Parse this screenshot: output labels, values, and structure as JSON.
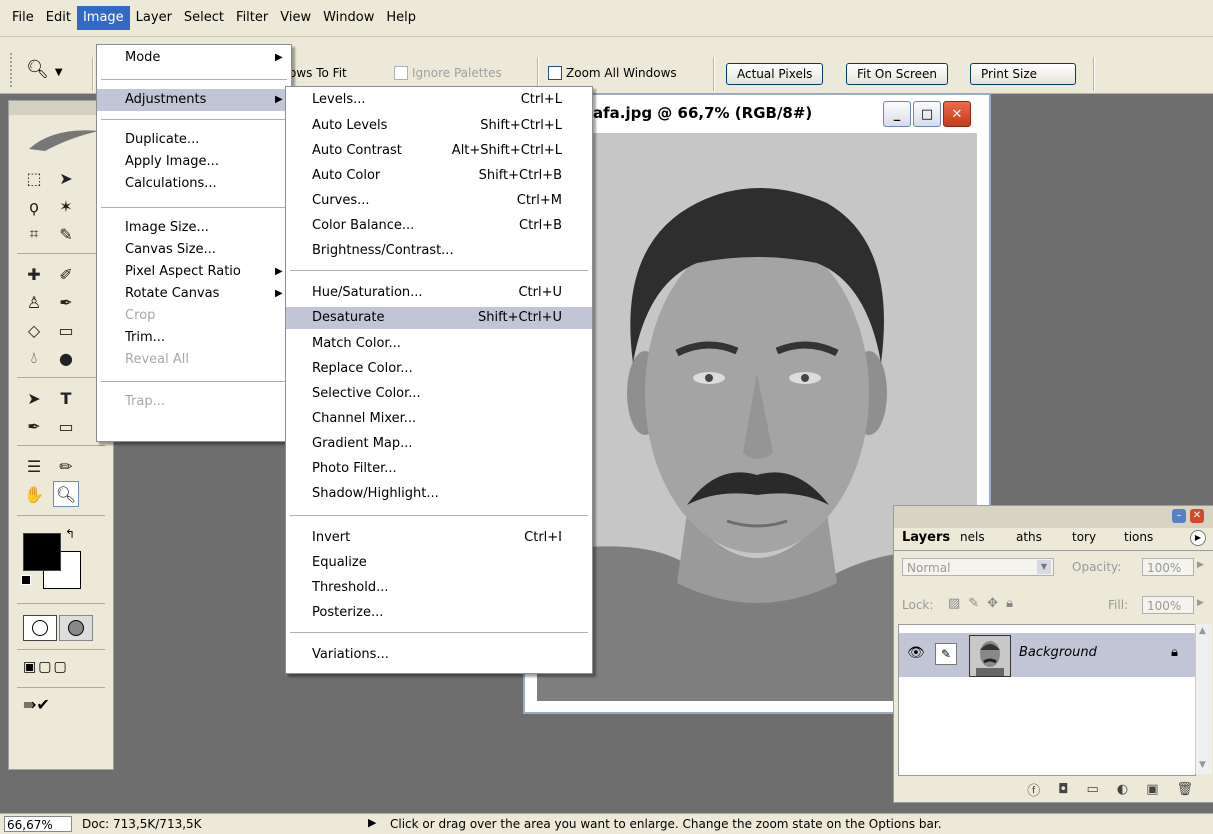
{
  "menubar": [
    "File",
    "Edit",
    "Image",
    "Layer",
    "Select",
    "Filter",
    "View",
    "Window",
    "Help"
  ],
  "options": {
    "resize_label": "ows To Fit",
    "ignore_palettes": "Ignore Palettes",
    "zoom_all": "Zoom All Windows",
    "actual_pixels": "Actual Pixels",
    "fit_on_screen": "Fit On Screen",
    "print_size": "Print Size"
  },
  "document": {
    "title": "afa.jpg @ 66,7% (RGB/8#)",
    "minimize": "_",
    "maximize": "□",
    "close": "✕"
  },
  "image_menu": {
    "items": [
      {
        "label": "Mode",
        "submenu": true
      },
      {
        "label": "Adjustments",
        "submenu": true
      },
      {
        "label": "Duplicate..."
      },
      {
        "label": "Apply Image..."
      },
      {
        "label": "Calculations..."
      },
      {
        "label": "Image Size..."
      },
      {
        "label": "Canvas Size..."
      },
      {
        "label": "Pixel Aspect Ratio",
        "submenu": true
      },
      {
        "label": "Rotate Canvas",
        "submenu": true
      },
      {
        "label": "Crop",
        "disabled": true
      },
      {
        "label": "Trim..."
      },
      {
        "label": "Reveal All",
        "disabled": true
      },
      {
        "label": "Trap...",
        "disabled": true
      }
    ]
  },
  "adjustments_menu": {
    "items": [
      {
        "label": "Levels...",
        "shortcut": "Ctrl+L"
      },
      {
        "label": "Auto Levels",
        "shortcut": "Shift+Ctrl+L"
      },
      {
        "label": "Auto Contrast",
        "shortcut": "Alt+Shift+Ctrl+L"
      },
      {
        "label": "Auto Color",
        "shortcut": "Shift+Ctrl+B"
      },
      {
        "label": "Curves...",
        "shortcut": "Ctrl+M"
      },
      {
        "label": "Color Balance...",
        "shortcut": "Ctrl+B"
      },
      {
        "label": "Brightness/Contrast...",
        "shortcut": ""
      },
      {
        "label": "Hue/Saturation...",
        "shortcut": "Ctrl+U"
      },
      {
        "label": "Desaturate",
        "shortcut": "Shift+Ctrl+U",
        "highlighted": true
      },
      {
        "label": "Match Color...",
        "shortcut": ""
      },
      {
        "label": "Replace Color...",
        "shortcut": ""
      },
      {
        "label": "Selective Color...",
        "shortcut": ""
      },
      {
        "label": "Channel Mixer...",
        "shortcut": ""
      },
      {
        "label": "Gradient Map...",
        "shortcut": ""
      },
      {
        "label": "Photo Filter...",
        "shortcut": ""
      },
      {
        "label": "Shadow/Highlight...",
        "shortcut": ""
      },
      {
        "label": "Invert",
        "shortcut": "Ctrl+I"
      },
      {
        "label": "Equalize",
        "shortcut": ""
      },
      {
        "label": "Threshold...",
        "shortcut": ""
      },
      {
        "label": "Posterize...",
        "shortcut": ""
      },
      {
        "label": "Variations...",
        "shortcut": ""
      }
    ]
  },
  "layers_panel": {
    "tabs": [
      "Layers",
      "nels",
      "aths",
      "tory",
      "tions"
    ],
    "blend_mode": "Normal",
    "opacity_label": "Opacity:",
    "opacity_value": "100%",
    "lock_label": "Lock:",
    "fill_label": "Fill:",
    "fill_value": "100%",
    "layer_name": "Background"
  },
  "statusbar": {
    "zoom": "66,67%",
    "doc": "Doc: 713,5K/713,5K",
    "hint": "Click or drag over the area you want to enlarge. Change the zoom state on the Options bar."
  }
}
